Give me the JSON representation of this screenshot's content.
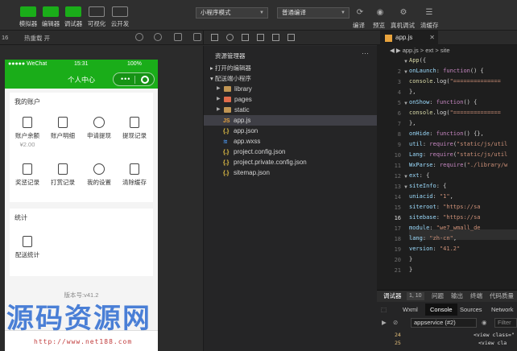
{
  "toolbar": {
    "simulator": "模拟器",
    "editor": "编辑器",
    "debugger": "调试器",
    "visual": "可视化",
    "cloud": "云开发",
    "mode": "小程序模式",
    "compile_mode": "普通编译",
    "compile": "编译",
    "preview": "预览",
    "real_debug": "真机调试",
    "clear_cache": "清缓存"
  },
  "simulator": {
    "device_prefix": "16",
    "zoom": "热重载 开",
    "status": {
      "carrier": "●●●●● WeChat",
      "time": "15:31",
      "battery": "100%"
    },
    "nav_title": "个人中心",
    "account_card": {
      "title": "我的账户",
      "items": [
        {
          "label": "账户余额",
          "sub": "¥2.00"
        },
        {
          "label": "账户明细",
          "sub": ""
        },
        {
          "label": "申请提现",
          "sub": ""
        },
        {
          "label": "提现记录",
          "sub": ""
        },
        {
          "label": "奖惩记录",
          "sub": ""
        },
        {
          "label": "打赏记录",
          "sub": ""
        },
        {
          "label": "我的设置",
          "sub": ""
        },
        {
          "label": "清除缓存",
          "sub": ""
        }
      ]
    },
    "stats_card": {
      "title": "统计",
      "items": [
        {
          "label": "配送统计"
        }
      ]
    },
    "version": "版本号:v41.2"
  },
  "explorer": {
    "title": "资源管理器",
    "open_editors": "打开的编辑器",
    "project": "配送端小程序",
    "tree": [
      {
        "name": "library",
        "type": "folder",
        "color": "#c09553"
      },
      {
        "name": "pages",
        "type": "folder",
        "color": "#e06c4b"
      },
      {
        "name": "static",
        "type": "folder",
        "color": "#c09553"
      },
      {
        "name": "app.js",
        "type": "js",
        "icon": "JS",
        "selected": true
      },
      {
        "name": "app.json",
        "type": "json",
        "icon": "{.}"
      },
      {
        "name": "app.wxss",
        "type": "wxss",
        "icon": "≋"
      },
      {
        "name": "project.config.json",
        "type": "json",
        "icon": "{.}"
      },
      {
        "name": "project.private.config.json",
        "type": "json",
        "icon": "{.}"
      },
      {
        "name": "sitemap.json",
        "type": "json",
        "icon": "{.}"
      }
    ]
  },
  "editor": {
    "tab": "app.js",
    "breadcrumb": "app.js > ext > site",
    "current_line": 16,
    "lines": [
      {
        "n": "",
        "code": "App({"
      },
      {
        "n": "2",
        "code": "  onLaunch: function() {"
      },
      {
        "n": "3",
        "code": "    console.log(\"=============="
      },
      {
        "n": "4",
        "code": "  },"
      },
      {
        "n": "5",
        "code": "  onShow: function() {"
      },
      {
        "n": "6",
        "code": "    console.log(\"=============="
      },
      {
        "n": "7",
        "code": "  },"
      },
      {
        "n": "8",
        "code": "  onHide: function() {},"
      },
      {
        "n": "9",
        "code": "  util: require(\"static/js/util"
      },
      {
        "n": "10",
        "code": "  Lang: require(\"static/js/util"
      },
      {
        "n": "11",
        "code": "  WxParse: require(\"./library/w"
      },
      {
        "n": "12",
        "code": "  ext: {"
      },
      {
        "n": "13",
        "code": "    siteInfo: {"
      },
      {
        "n": "14",
        "code": "      uniacid: \"1\","
      },
      {
        "n": "15",
        "code": "      siteroot: \"https://sa"
      },
      {
        "n": "16",
        "code": "      sitebase: \"https://sa"
      },
      {
        "n": "17",
        "code": "      module: \"we7_wmall_de"
      },
      {
        "n": "18",
        "code": "      lang: \"zh-cn\","
      },
      {
        "n": "19",
        "code": "      version: \"41.2\""
      },
      {
        "n": "20",
        "code": "    }"
      },
      {
        "n": "21",
        "code": "  }"
      }
    ]
  },
  "debugger": {
    "tab_debug": "调试器",
    "badge": "1, 10",
    "tab_problems": "问题",
    "tab_output": "输出",
    "tab_terminal": "终端",
    "tab_code": "代码质量",
    "sub_wxml": "Wxml",
    "sub_console": "Console",
    "sub_sources": "Sources",
    "sub_network": "Network",
    "context": "appservice (#2)",
    "filter": "Filter",
    "console_lines": [
      {
        "n": "24",
        "text": "<view class=\""
      },
      {
        "n": "25",
        "text": "<view cla"
      }
    ]
  },
  "watermark": {
    "text": "源码资源网",
    "url": "http://www.net188.com"
  }
}
